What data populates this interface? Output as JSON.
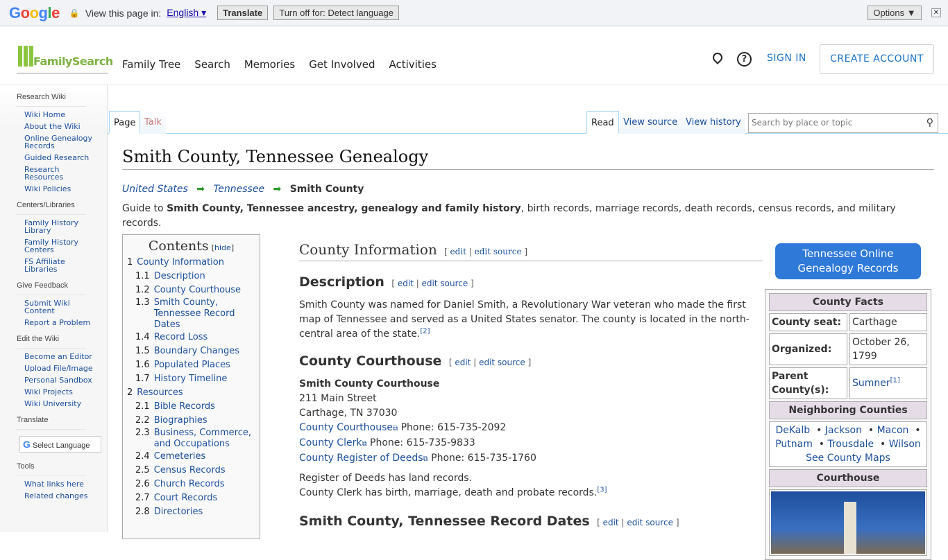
{
  "translate_bar": {
    "logo": "Google",
    "view_text": "View this page in:",
    "language": "English",
    "translate": "Translate",
    "turn_off": "Turn off for: Detect language",
    "options": "Options ▼",
    "close": "✕"
  },
  "header": {
    "logo": "FamilySearch",
    "nav": [
      "Family Tree",
      "Search",
      "Memories",
      "Get Involved",
      "Activities"
    ],
    "sign_in": "SIGN IN",
    "create_account": "CREATE ACCOUNT"
  },
  "sidebar": [
    {
      "title": "Research Wiki",
      "items": [
        "Wiki Home",
        "About the Wiki",
        "Online Genealogy Records",
        "Guided Research",
        "Research Resources",
        "Wiki Policies"
      ]
    },
    {
      "title": "Centers/Libraries",
      "items": [
        "Family History Library",
        "Family History Centers",
        "FS Affiliate Libraries"
      ]
    },
    {
      "title": "Give Feedback",
      "items": [
        "Submit Wiki Content",
        "Report a Problem"
      ]
    },
    {
      "title": "Edit the Wiki",
      "items": [
        "Become an Editor",
        "Upload File/Image",
        "Personal Sandbox",
        "Wiki Projects",
        "Wiki University"
      ]
    },
    {
      "title": "Translate",
      "items": []
    },
    {
      "title": "Tools",
      "items": [
        "What links here",
        "Related changes"
      ]
    }
  ],
  "select_language": "Select Language",
  "tabs": {
    "page": "Page",
    "talk": "Talk",
    "read": "Read",
    "view_source": "View source",
    "view_history": "View history",
    "search_placeholder": "Search by place or topic"
  },
  "page": {
    "title": "Smith County, Tennessee Genealogy",
    "breadcrumb": [
      "United States",
      "Tennessee",
      "Smith County"
    ],
    "intro_prefix": "Guide to ",
    "intro_bold": "Smith County, Tennessee ancestry, genealogy and family history",
    "intro_suffix": ", birth records, marriage records, death records, census records, and military records.",
    "edit": "edit",
    "edit_source": "edit source",
    "h_county_info": "County Information",
    "h_description": "Description",
    "description": "Smith County was named for Daniel Smith, a Revolutionary War veteran who made the first map of Tennessee and served as a United States senator. The county is located in the north-central area of the state.",
    "desc_ref": "[2]",
    "h_courthouse": "County Courthouse",
    "courthouse_name": "Smith County Courthouse",
    "address1": "211 Main Street",
    "address2": "Carthage, TN 37030",
    "contacts": [
      {
        "link": "County Courthouse",
        "phone": " Phone: 615-735-2092"
      },
      {
        "link": "County Clerk",
        "phone": " Phone: 615-735-9833"
      },
      {
        "link": "County Register of Deeds",
        "phone": " Phone: 615-735-1760"
      }
    ],
    "note1": "Register of Deeds has land records.",
    "note2": "County Clerk has birth, marriage, death and probate records.",
    "note_ref": "[3]",
    "h_record_dates": "Smith County, Tennessee Record Dates"
  },
  "toc": {
    "title": "Contents",
    "hide": "hide",
    "items": [
      [
        "1",
        "County Information",
        0
      ],
      [
        "1.1",
        "Description",
        1
      ],
      [
        "1.2",
        "County Courthouse",
        1
      ],
      [
        "1.3",
        "Smith County, Tennessee Record Dates",
        1
      ],
      [
        "1.4",
        "Record Loss",
        1
      ],
      [
        "1.5",
        "Boundary Changes",
        1
      ],
      [
        "1.6",
        "Populated Places",
        1
      ],
      [
        "1.7",
        "History Timeline",
        1
      ],
      [
        "2",
        "Resources",
        0
      ],
      [
        "2.1",
        "Bible Records",
        1
      ],
      [
        "2.2",
        "Biographies",
        1
      ],
      [
        "2.3",
        "Business, Commerce, and Occupations",
        1
      ],
      [
        "2.4",
        "Cemeteries",
        1
      ],
      [
        "2.5",
        "Census Records",
        1
      ],
      [
        "2.6",
        "Church Records",
        1
      ],
      [
        "2.7",
        "Court Records",
        1
      ],
      [
        "2.8",
        "Directories",
        1
      ]
    ]
  },
  "infobox": {
    "button": "Tennessee Online Genealogy Records",
    "facts_title": "County Facts",
    "seat_label": "County seat:",
    "seat": "Carthage",
    "organized_label": "Organized:",
    "organized": "October 26, 1799",
    "parent_label": "Parent County(s):",
    "parent": "Sumner",
    "parent_ref": "[1]",
    "neighbors_title": "Neighboring Counties",
    "neighbors": [
      "DeKalb",
      "Jackson",
      "Macon",
      "Putnam",
      "Trousdale",
      "Wilson"
    ],
    "see_maps": "See County Maps",
    "courthouse_title": "Courthouse"
  }
}
